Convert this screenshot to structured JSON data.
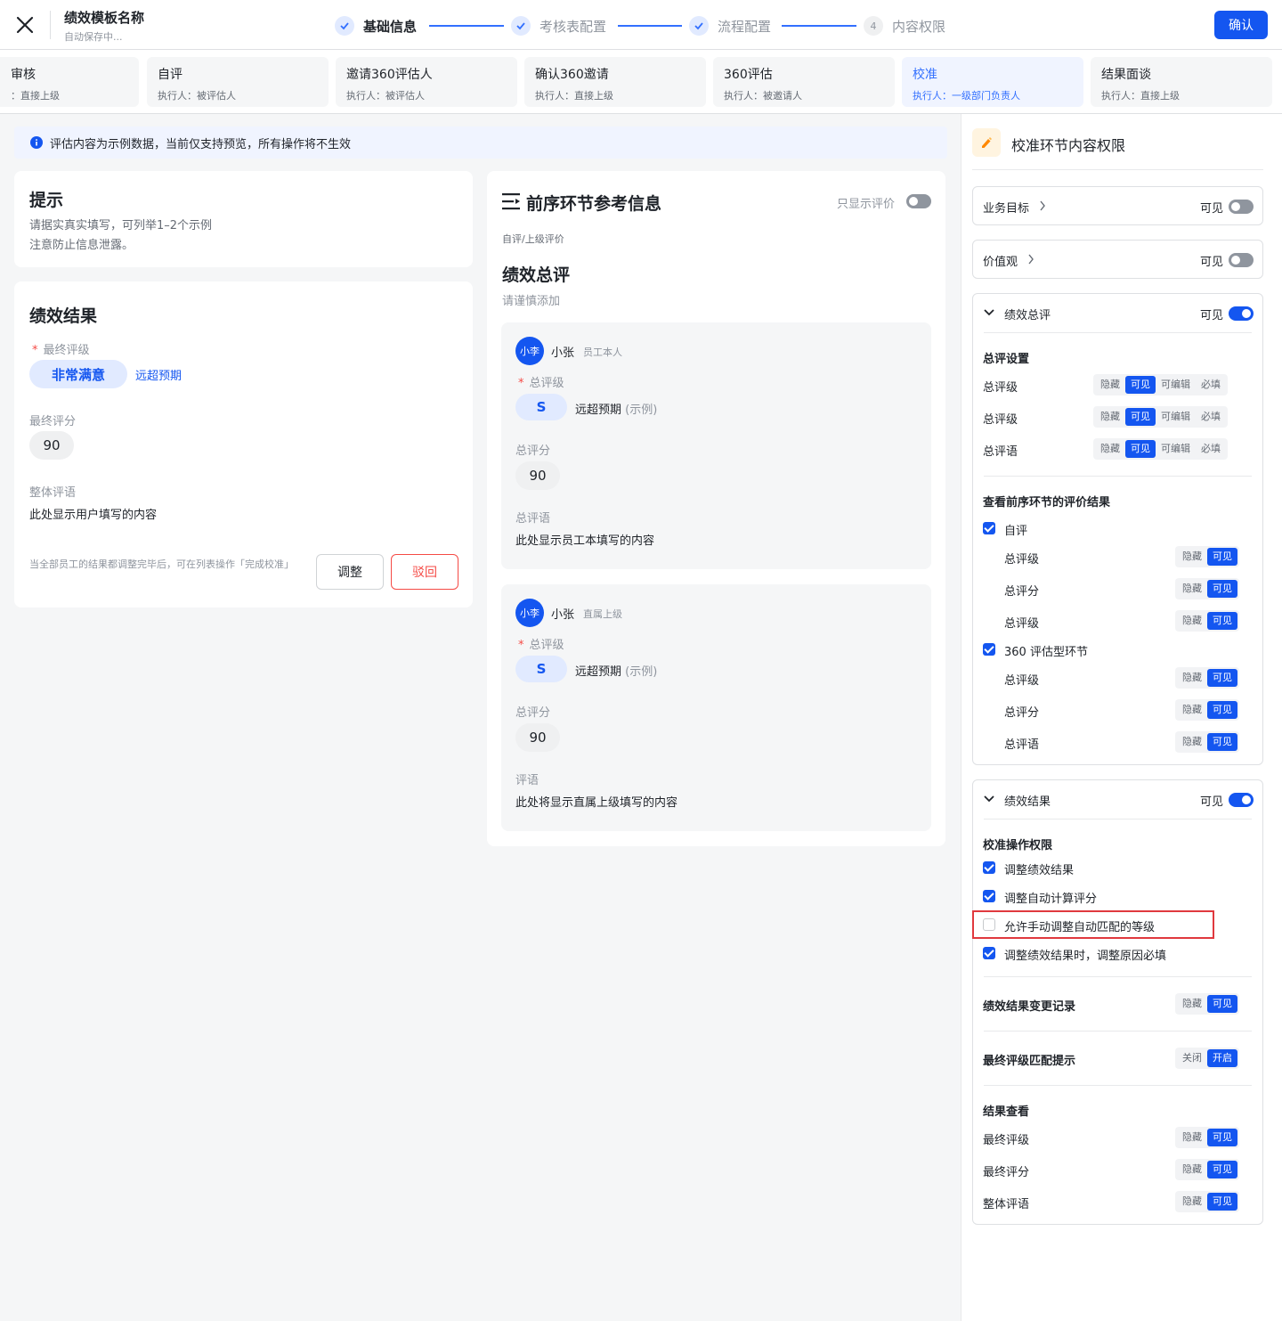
{
  "header": {
    "title": "绩效模板名称",
    "subtitle": "自动保存中...",
    "confirm": "确认"
  },
  "steps": [
    {
      "label": "基础信息"
    },
    {
      "label": "考核表配置"
    },
    {
      "label": "流程配置"
    },
    {
      "label": "内容权限",
      "num": "4"
    }
  ],
  "nodes": [
    {
      "title": "审核",
      "sub": "：直接上级"
    },
    {
      "title": "自评",
      "sub": "执行人：被评估人"
    },
    {
      "title": "邀请360评估人",
      "sub": "执行人：被评估人"
    },
    {
      "title": "确认360邀请",
      "sub": "执行人：直接上级"
    },
    {
      "title": "360评估",
      "sub": "执行人：被邀请人"
    },
    {
      "title": "校准",
      "sub": "执行人：一级部门负责人"
    },
    {
      "title": "结果面谈",
      "sub": "执行人：直接上级"
    }
  ],
  "notice": "评估内容为示例数据，当前仅支持预览，所有操作将不生效",
  "tip": {
    "title": "提示",
    "line1": "请据实真实填写，可列举1–2个示例",
    "line2": "注意防止信息泄露。"
  },
  "result": {
    "title": "绩效结果",
    "grade_label": "最终评级",
    "grade_value": "非常满意",
    "grade_desc": "远超预期",
    "score_label": "最终评分",
    "score_value": "90",
    "comment_label": "整体评语",
    "comment_value": "此处显示用户填写的内容",
    "hint": "当全部员工的结果都调整完毕后，可在列表操作「完成校准」",
    "adjust": "调整",
    "reject": "驳回"
  },
  "prev": {
    "title": "前序环节参考信息",
    "toggle_label": "只显示评价",
    "crumb": "自评/上级评价",
    "section": "绩效总评",
    "section_sub": "请谨慎添加",
    "cards": [
      {
        "avatar": "小李",
        "name": "小张",
        "role": "员工本人",
        "grade_label": "总评级",
        "grade": "S",
        "grade_desc": "远超预期",
        "grade_note": "(示例)",
        "score_label": "总评分",
        "score": "90",
        "comment_label": "总评语",
        "comment": "此处显示员工本填写的内容"
      },
      {
        "avatar": "小李",
        "name": "小张",
        "role": "直属上级",
        "grade_label": "总评级",
        "grade": "S",
        "grade_desc": "远超预期",
        "grade_note": "(示例)",
        "score_label": "总评分",
        "score": "90",
        "comment_label": "评语",
        "comment": "此处将显示直属上级填写的内容"
      }
    ]
  },
  "side": {
    "title": "校准环节内容权限",
    "visible": "可见",
    "biz": "业务目标",
    "values": "价值观",
    "summary": {
      "title": "绩效总评",
      "setting": "总评设置",
      "rows": [
        "总评级",
        "总评级",
        "总评语"
      ],
      "seg4": [
        "隐藏",
        "可见",
        "可编辑",
        "必填"
      ],
      "view_title": "查看前序环节的评价结果",
      "self": "自评",
      "self_rows": [
        "总评级",
        "总评分",
        "总评级"
      ],
      "r360": "360 评估型环节",
      "r360_rows": [
        "总评级",
        "总评分",
        "总评语"
      ],
      "seg2": [
        "隐藏",
        "可见"
      ]
    },
    "result": {
      "title": "绩效结果",
      "ops_title": "校准操作权限",
      "ops": [
        "调整绩效结果",
        "调整自动计算评分",
        "允许手动调整自动匹配的等级",
        "调整绩效结果时，调整原因必填"
      ],
      "log": "绩效结果变更记录",
      "match": "最终评级匹配提示",
      "match_seg": [
        "关闭",
        "开启"
      ],
      "view": "结果查看",
      "view_rows": [
        "最终评级",
        "最终评分",
        "整体评语"
      ]
    }
  }
}
